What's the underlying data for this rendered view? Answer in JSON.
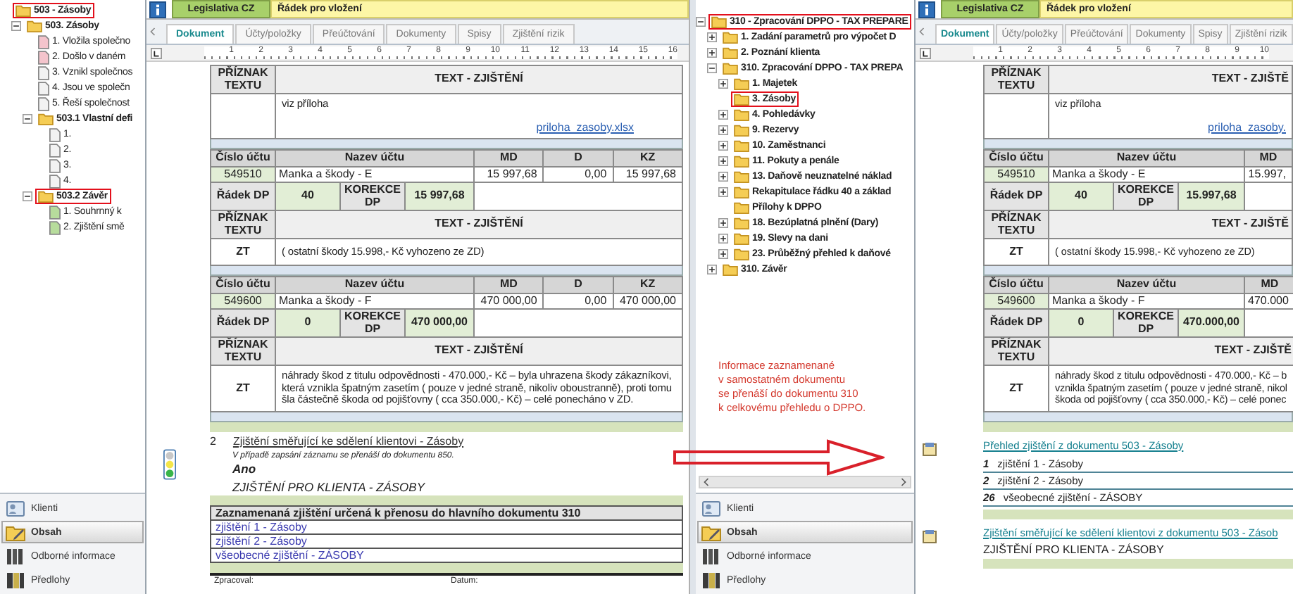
{
  "sidebars": [
    {
      "tree": [
        {
          "label": "503 - Zásoby",
          "kind": "folder",
          "highlighted": true,
          "children": [
            {
              "label": "503. Zásoby",
              "kind": "folder",
              "expanded": true,
              "highlighted": false,
              "children": [
                {
                  "label": "1. Vložila společno",
                  "kind": "doc-pink",
                  "highlighted": false
                },
                {
                  "label": "2. Došlo v daném",
                  "kind": "doc-pink",
                  "highlighted": false
                },
                {
                  "label": "3. Vznikl společnos",
                  "kind": "doc",
                  "highlighted": false
                },
                {
                  "label": "4. Jsou ve společn",
                  "kind": "doc",
                  "highlighted": false
                },
                {
                  "label": "5. Řeší společnost",
                  "kind": "doc",
                  "highlighted": false
                },
                {
                  "label": "503.1 Vlastní defi",
                  "kind": "folder",
                  "expanded": true,
                  "highlighted": false,
                  "children": [
                    {
                      "label": "1.",
                      "kind": "doc",
                      "highlighted": false
                    },
                    {
                      "label": "2.",
                      "kind": "doc",
                      "highlighted": false
                    },
                    {
                      "label": "3.",
                      "kind": "doc",
                      "highlighted": false
                    },
                    {
                      "label": "4.",
                      "kind": "doc",
                      "highlighted": false
                    }
                  ]
                },
                {
                  "label": "503.2 Závěr",
                  "kind": "folder",
                  "expanded": true,
                  "highlighted": true,
                  "children": [
                    {
                      "label": "1. Souhrnný k",
                      "kind": "doc-green",
                      "highlighted": false
                    },
                    {
                      "label": "2. Zjištění smě",
                      "kind": "doc-green",
                      "highlighted": false
                    }
                  ]
                }
              ]
            }
          ]
        }
      ],
      "nav": [
        {
          "label": "Klienti",
          "selected": false
        },
        {
          "label": "Obsah",
          "selected": true
        },
        {
          "label": "Odborné informace",
          "selected": false
        },
        {
          "label": "Předlohy",
          "selected": false
        }
      ]
    },
    {
      "tree": [
        {
          "label": "310 - Zpracování DPPO - TAX PREPARE",
          "kind": "folder",
          "expanded": true,
          "highlighted": true,
          "children": [
            {
              "label": "1. Zadání parametrů pro výpočet D",
              "kind": "folder",
              "expanded": false,
              "highlighted": false
            },
            {
              "label": "2. Poznání klienta",
              "kind": "folder",
              "expanded": false,
              "highlighted": false
            },
            {
              "label": "310. Zpracování DPPO - TAX PREPA",
              "kind": "folder",
              "expanded": true,
              "highlighted": false,
              "children": [
                {
                  "label": "1. Majetek",
                  "kind": "folder",
                  "expanded": false,
                  "highlighted": false
                },
                {
                  "label": "3. Zásoby",
                  "kind": "folder",
                  "highlighted": true
                },
                {
                  "label": "4. Pohledávky",
                  "kind": "folder",
                  "expanded": false,
                  "highlighted": false
                },
                {
                  "label": "9. Rezervy",
                  "kind": "folder",
                  "expanded": false,
                  "highlighted": false
                },
                {
                  "label": "10. Zaměstnanci",
                  "kind": "folder",
                  "expanded": false,
                  "highlighted": false
                },
                {
                  "label": "11. Pokuty a penále",
                  "kind": "folder",
                  "expanded": false,
                  "highlighted": false
                },
                {
                  "label": "13. Daňově neuznatelné náklad",
                  "kind": "folder",
                  "expanded": false,
                  "highlighted": false
                },
                {
                  "label": "Rekapitulace řádku 40 a základ",
                  "kind": "folder",
                  "expanded": false,
                  "highlighted": false
                },
                {
                  "label": "Přílohy k DPPO",
                  "kind": "folder",
                  "highlighted": false
                },
                {
                  "label": "18. Bezúplatná plnění (Dary)",
                  "kind": "folder",
                  "expanded": false,
                  "highlighted": false
                },
                {
                  "label": "19. Slevy na dani",
                  "kind": "folder",
                  "expanded": false,
                  "highlighted": false
                },
                {
                  "label": "23. Průběžný přehled k daňové",
                  "kind": "folder",
                  "expanded": false,
                  "highlighted": false
                }
              ]
            },
            {
              "label": "310. Závěr",
              "kind": "folder",
              "expanded": false,
              "highlighted": false
            }
          ]
        }
      ],
      "note": "Informace zaznamenané\nv samostatném dokumentu\nse přenáší do dokumentu 310\nk celkovému přehledu o DPPO.",
      "nav": [
        {
          "label": "Klienti",
          "selected": false
        },
        {
          "label": "Obsah",
          "selected": true
        },
        {
          "label": "Odborné informace",
          "selected": false
        },
        {
          "label": "Předlohy",
          "selected": false
        }
      ]
    }
  ],
  "documents": [
    {
      "header": {
        "legislation": "Legislativa CZ",
        "insert_row": "Řádek pro vložení"
      },
      "tabs": [
        {
          "label": "Dokument",
          "selected": true
        },
        {
          "label": "Účty/položky",
          "selected": false
        },
        {
          "label": "Přeúčtování",
          "selected": false
        },
        {
          "label": "Dokumenty",
          "selected": false
        },
        {
          "label": "Spisy",
          "selected": false
        },
        {
          "label": "Zjištění rizik",
          "selected": false
        }
      ],
      "ruler": [
        "1",
        "2",
        "3",
        "4",
        "5",
        "6",
        "7",
        "8",
        "9",
        "10",
        "11",
        "12",
        "13",
        "14",
        "15",
        "16"
      ],
      "groups": [
        [
          {
            "kind": "flag",
            "label": "PŘÍZNAK TEXTU",
            "heading": "TEXT - ZJIŠTĚNÍ"
          },
          {
            "kind": "text",
            "text": "viz příloha",
            "link": "priloha_zasoby.xlsx"
          }
        ],
        [
          {
            "kind": "accounts-head",
            "columns": [
              "Číslo účtu",
              "Nazev účtu",
              "MD",
              "D",
              "KZ"
            ]
          },
          {
            "kind": "account",
            "number": "549510",
            "name": "Manka a škody - E",
            "amounts": [
              "15 997,68",
              "0,00",
              "15 997,68"
            ]
          },
          {
            "kind": "dp",
            "label": "Řádek DP",
            "row": "40",
            "correction_label": "KOREKCE DP",
            "correction": "15 997,68"
          },
          {
            "kind": "flag",
            "label": "PŘÍZNAK TEXTU",
            "heading": "TEXT - ZJIŠTĚNÍ"
          },
          {
            "kind": "text",
            "code": "ZT",
            "text": "( ostatní škody  15.998,- Kč vyhozeno ze ZD)"
          }
        ],
        [
          {
            "kind": "accounts-head",
            "columns": [
              "Číslo účtu",
              "Nazev účtu",
              "MD",
              "D",
              "KZ"
            ]
          },
          {
            "kind": "account",
            "number": "549600",
            "name": "Manka a škody - F",
            "amounts": [
              "470 000,00",
              "0,00",
              "470 000,00"
            ]
          },
          {
            "kind": "dp",
            "label": "Řádek DP",
            "row": "0",
            "correction_label": "KOREKCE DP",
            "correction": "470 000,00"
          },
          {
            "kind": "flag",
            "label": "PŘÍZNAK TEXTU",
            "heading": "TEXT - ZJIŠTĚNÍ"
          },
          {
            "kind": "text",
            "code": "ZT",
            "text": "náhrady škod z titulu odpovědnosti -  470.000,- Kč – byla uhrazena škody zákazníkovi, která vznikla špatným zasetím ( pouze v jedné straně, nikoliv oboustranně), proti tomu šla částečně škoda od pojišťovny ( cca 350.000,- Kč) – celé ponecháno v ZD."
          }
        ]
      ],
      "finding": {
        "number": "2",
        "title": "Zjištění směřující ke sdělení klientovi - Zásoby",
        "note": "V případě zapsání záznamu se přenáší do dokumentu 850.",
        "answer": "Ano",
        "heading": "ZJIŠTĚNÍ PRO KLIENTA - ZÁSOBY"
      },
      "transfer_table": {
        "title": "Zaznamenaná zjištění určená k přenosu do hlavního dokumentu 310",
        "items": [
          "zjištění 1 - Zásoby",
          "zjištění 2 - Zásoby",
          "všeobecné zjištění - ZÁSOBY"
        ]
      },
      "signature": [
        "Zpracoval:",
        "Datum:"
      ]
    },
    {
      "header": {
        "legislation": "Legislativa CZ",
        "insert_row": "Řádek pro vložení"
      },
      "tabs": [
        {
          "label": "Dokument",
          "selected": true
        },
        {
          "label": "Účty/položky",
          "selected": false
        },
        {
          "label": "Přeúčtování",
          "selected": false
        },
        {
          "label": "Dokumenty",
          "selected": false
        },
        {
          "label": "Spisy",
          "selected": false
        },
        {
          "label": "Zjištění rizik",
          "selected": false
        }
      ],
      "ruler": [
        "1",
        "2",
        "3",
        "4",
        "5",
        "6",
        "7",
        "8",
        "9",
        "10"
      ],
      "groups": [
        [
          {
            "kind": "flag",
            "label": "PŘÍZNAK TEXTU",
            "heading": "TEXT - ZJIŠTĚ"
          },
          {
            "kind": "text",
            "text": "viz příloha",
            "link": "priloha_zasoby."
          }
        ],
        [
          {
            "kind": "accounts-head",
            "columns": [
              "Číslo účtu",
              "Nazev účtu",
              "MD"
            ]
          },
          {
            "kind": "account",
            "number": "549510",
            "name": "Manka a škody - E",
            "amounts": [
              "15.997,"
            ]
          },
          {
            "kind": "dp",
            "label": "Řádek DP",
            "row": "40",
            "correction_label": "KOREKCE DP",
            "correction": "15.997,68"
          },
          {
            "kind": "flag",
            "label": "PŘÍZNAK TEXTU",
            "heading": "TEXT - ZJIŠTĚ"
          },
          {
            "kind": "text",
            "code": "ZT",
            "text": "( ostatní škody  15.998,- Kč vyhozeno ze ZD)"
          }
        ],
        [
          {
            "kind": "accounts-head",
            "columns": [
              "Číslo účtu",
              "Nazev účtu",
              "MD"
            ]
          },
          {
            "kind": "account",
            "number": "549600",
            "name": "Manka a škody - F",
            "amounts": [
              "470.000"
            ]
          },
          {
            "kind": "dp",
            "label": "Řádek DP",
            "row": "0",
            "correction_label": "KOREKCE DP",
            "correction": "470.000,00"
          },
          {
            "kind": "flag",
            "label": "PŘÍZNAK TEXTU",
            "heading": "TEXT - ZJIŠTĚ"
          },
          {
            "kind": "text",
            "code": "ZT",
            "lines": [
              "náhrady škod z titulu odpovědnosti -  470.000,- Kč – b",
              "vznikla špatným zasetím ( pouze v jedné straně, nikol",
              "škoda od pojišťovny ( cca 350.000,- Kč) – celé ponec"
            ]
          }
        ]
      ],
      "overview": {
        "title": "Přehled zjištění z dokumentu 503 - Zásoby",
        "items": [
          {
            "number": "1",
            "text": "zjištění 1 - Zásoby"
          },
          {
            "number": "2",
            "text": "zjištění 2 - Zásoby"
          },
          {
            "number": "26",
            "text": "všeobecné zjištění - ZÁSOBY"
          }
        ]
      },
      "client_findings": {
        "title": "Zjištění směřující ke sdělení klientovi z dokumentu 503 - Zásob",
        "text": "ZJIŠTĚNÍ PRO KLIENTA - ZÁSOBY"
      }
    }
  ]
}
